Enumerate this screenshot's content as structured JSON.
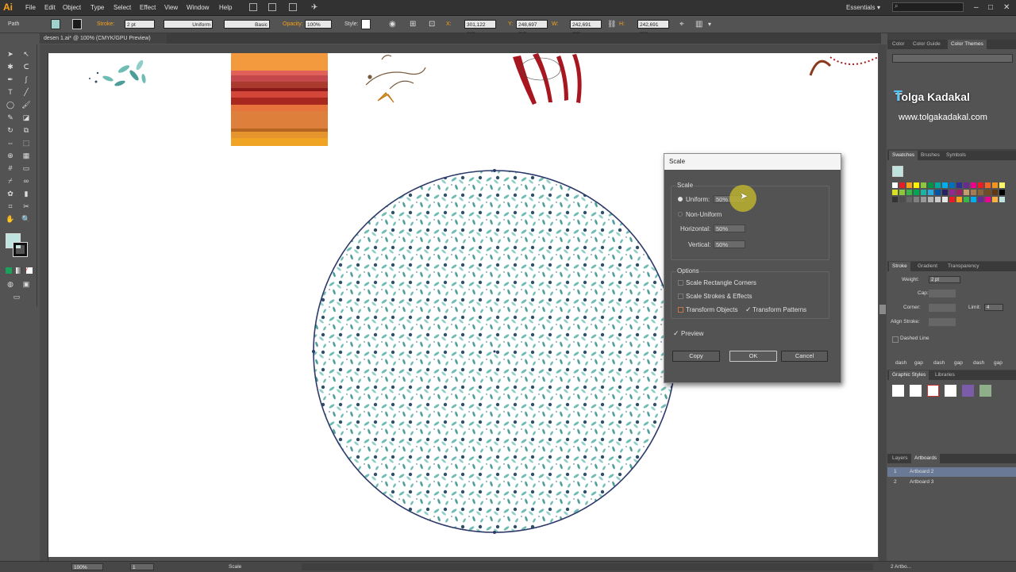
{
  "app": {
    "logo": "Ai"
  },
  "menubar": {
    "items": [
      "File",
      "Edit",
      "Object",
      "Type",
      "Select",
      "Effect",
      "View",
      "Window",
      "Help"
    ],
    "workspace": "Essentials",
    "window_controls": [
      "–",
      "□",
      "✕"
    ]
  },
  "controlbar": {
    "selection": "Path",
    "stroke_label": "Stroke:",
    "stroke_weight": "2 pt",
    "profile": "Uniform",
    "brush": "Basic",
    "opacity_label": "Opacity:",
    "opacity": "100%",
    "style_label": "Style:",
    "x_label": "X:",
    "x_value": "301,122 mm",
    "y_label": "Y:",
    "y_value": "248,697 mm",
    "w_label": "W:",
    "w_value": "242,691 mm",
    "h_label": "H:",
    "h_value": "242,691 mm"
  },
  "document": {
    "tab_title": "desen 1.ai* @ 100% (CMYK/GPU Preview)"
  },
  "statusbar": {
    "zoom": "100%",
    "page": "1",
    "tool_status": "Scale"
  },
  "panels": {
    "color_tabs": [
      "Color",
      "Color Guide",
      "Color Themes"
    ],
    "watermark_name": "Tolga Kadakal",
    "watermark_url": "www.tolgakadakal.com",
    "swatch_tabs": [
      "Swatches",
      "Brushes",
      "Symbols"
    ],
    "stroke_tabs": [
      "Stroke",
      "Gradient",
      "Transparency"
    ],
    "weight_label": "Weight:",
    "weight_value": "2 pt",
    "cap_label": "Cap:",
    "corner_label": "Corner:",
    "limit_label": "Limit:",
    "limit_value": "4",
    "align_label": "Align Stroke:",
    "dashed_label": "Dashed Line",
    "dash_labels": [
      "dash",
      "gap",
      "dash",
      "gap",
      "dash",
      "gap"
    ],
    "graphic_tabs": [
      "Graphic Styles",
      "Libraries"
    ],
    "layer_tabs": [
      "Layers",
      "Artboards"
    ],
    "artboards": [
      {
        "num": "1",
        "name": "Artboard 2"
      },
      {
        "num": "2",
        "name": "Artboard 3"
      }
    ],
    "artboard_count": "2 Artbo..."
  },
  "dialog": {
    "title": "Scale",
    "scale_group": "Scale",
    "uniform_label": "Uniform:",
    "uniform_value": "50%",
    "nonuniform_label": "Non-Uniform",
    "horizontal_label": "Horizontal:",
    "horizontal_value": "50%",
    "vertical_label": "Vertical:",
    "vertical_value": "50%",
    "options_group": "Options",
    "opt_scale_corners": "Scale Rectangle Corners",
    "opt_scale_strokes": "Scale Strokes & Effects",
    "opt_transform_objects": "Transform Objects",
    "opt_transform_patterns": "Transform Patterns",
    "preview_label": "Preview",
    "copy_button": "Copy",
    "ok_button": "OK",
    "cancel_button": "Cancel"
  },
  "colors": {
    "accent": "#f7a21b",
    "pattern_leaf": "#6fbcb4",
    "pattern_dot": "#2f4f6a"
  }
}
